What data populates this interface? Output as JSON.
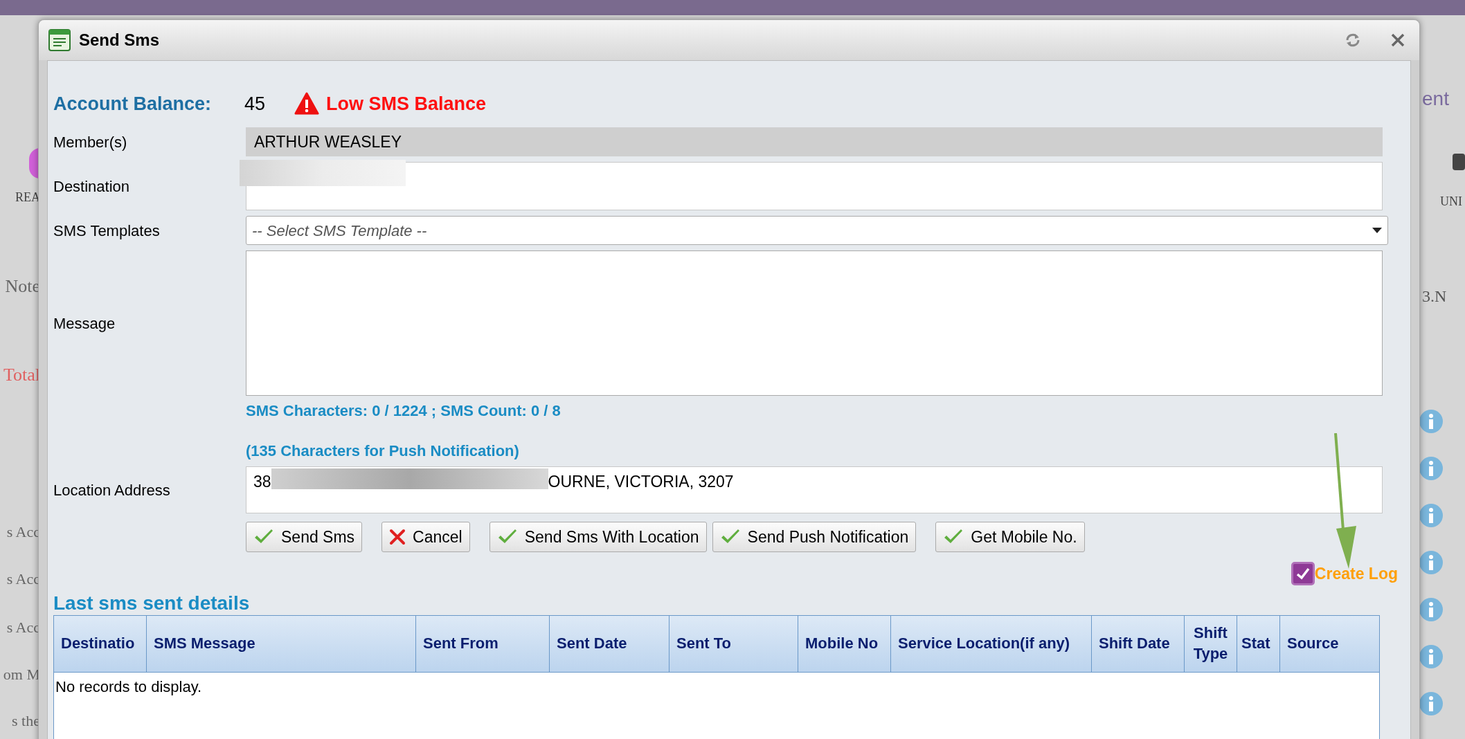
{
  "background": {
    "left_texts": [
      "REA",
      "Note",
      "Total",
      "s Acc",
      "s Acc",
      "s Acc",
      "om M",
      "s the"
    ],
    "right_heading": "ent",
    "right_button": "UNI",
    "right_columns": [
      "3.N"
    ],
    "info_rows": [
      "",
      "",
      "",
      "",
      "",
      "",
      ""
    ]
  },
  "dialog": {
    "title": "Send Sms",
    "balance": {
      "label": "Account Balance:",
      "value": "45",
      "warning": "Low SMS Balance"
    },
    "members": {
      "label": "Member(s)",
      "value": "ARTHUR WEASLEY"
    },
    "destination": {
      "label": "Destination"
    },
    "templates": {
      "label": "SMS Templates",
      "placeholder": "-- Select SMS Template --"
    },
    "message": {
      "label": "Message",
      "counter": "SMS Characters: 0 / 1224 ; SMS Count: 0 / 8",
      "push_note": "(135 Characters for Push Notification)"
    },
    "location": {
      "label": "Location Address",
      "value_start": "38",
      "value_end": "OURNE, VICTORIA, 3207"
    },
    "buttons": [
      {
        "label": "Send Sms",
        "kind": "ok"
      },
      {
        "label": "Cancel",
        "kind": "cancel"
      },
      {
        "label": "Send Sms With Location",
        "kind": "ok"
      },
      {
        "label": "Send Push Notification",
        "kind": "ok"
      },
      {
        "label": "Get Mobile No.",
        "kind": "ok"
      }
    ],
    "create_log": {
      "label": "Create Log",
      "checked": true
    },
    "history": {
      "title": "Last sms sent details",
      "columns": [
        "Destinatio",
        "SMS Message",
        "Sent From",
        "Sent Date",
        "Sent To",
        "Mobile No",
        "Service Location(if any)",
        "Shift Date",
        "Shift Type",
        "Stat",
        "Source"
      ],
      "empty": "No records to display."
    }
  }
}
